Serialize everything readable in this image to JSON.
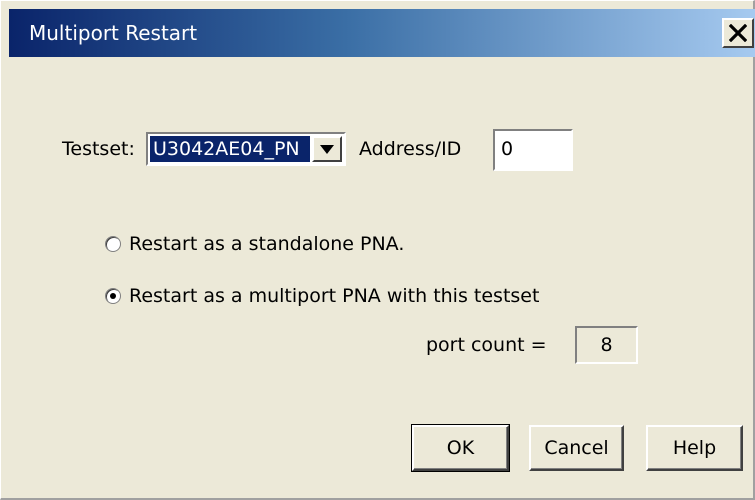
{
  "window": {
    "title": "Multiport Restart",
    "close_icon": "close-icon"
  },
  "testset": {
    "label": "Testset:",
    "value": "U3042AE04_PN",
    "dropdown_icon": "chevron-down-icon"
  },
  "address": {
    "label": "Address/ID",
    "value": "0"
  },
  "options": [
    {
      "label": "Restart as a standalone PNA.",
      "selected": false
    },
    {
      "label": "Restart as a multiport PNA with this testset",
      "selected": true
    }
  ],
  "port_count": {
    "label": "port count =",
    "value": "8"
  },
  "buttons": {
    "ok": "OK",
    "cancel": "Cancel",
    "help": "Help"
  },
  "colors": {
    "titlebar_start": "#0a246a",
    "titlebar_end": "#a6caf0",
    "face": "#ece9d8",
    "selection": "#0a246a"
  }
}
